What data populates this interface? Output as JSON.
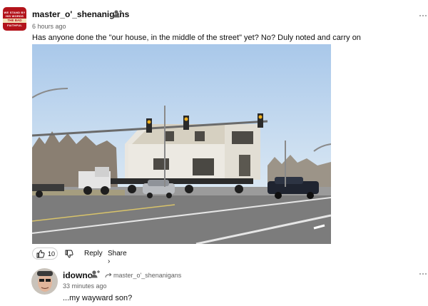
{
  "comment1": {
    "avatar_lines": [
      "WE STAND BY",
      "HIS WORDS",
      "THE BAD",
      "FAITHFUL"
    ],
    "username": "master_o'_shenanigans",
    "time": "6 hours ago",
    "text": "Has anyone done the \"our house, in the middle of the street\" yet? No? Duly noted and carry on",
    "photo_alt": "House being moved on a truck down the middle of the street",
    "like_count": "10",
    "reply_label": "Reply",
    "share_label": "Share ›"
  },
  "comment2": {
    "username": "idowno",
    "replying_to": "master_o'_shenanigans",
    "time": "33 minutes ago",
    "text": "...my wayward son?"
  },
  "colors": {
    "avatar_red": "#b3141b",
    "meta_gray": "#606060"
  }
}
